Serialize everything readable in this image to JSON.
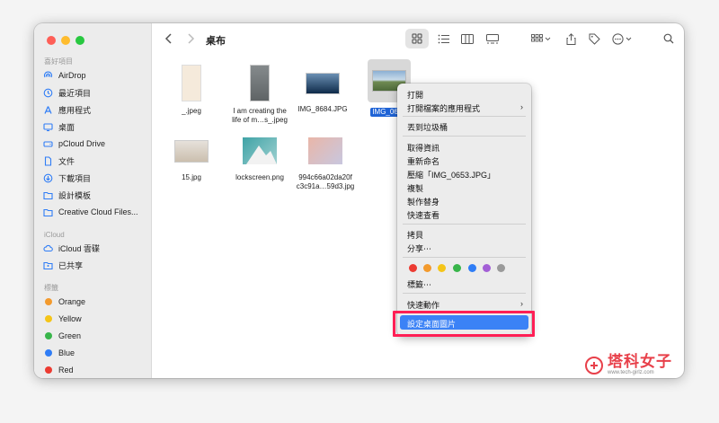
{
  "toolbar": {
    "title": "桌布"
  },
  "sidebar": {
    "favorites_title": "喜好項目",
    "favorites": [
      {
        "label": "AirDrop",
        "icon": "airdrop-icon"
      },
      {
        "label": "最近項目",
        "icon": "clock-icon"
      },
      {
        "label": "應用程式",
        "icon": "apps-icon"
      },
      {
        "label": "桌面",
        "icon": "desktop-icon"
      },
      {
        "label": "pCloud Drive",
        "icon": "drive-icon"
      },
      {
        "label": "文件",
        "icon": "document-icon"
      },
      {
        "label": "下載項目",
        "icon": "download-icon"
      },
      {
        "label": "設計模板",
        "icon": "folder-icon"
      },
      {
        "label": "Creative Cloud Files...",
        "icon": "folder-icon"
      }
    ],
    "icloud_title": "iCloud",
    "icloud": [
      {
        "label": "iCloud 雲碟",
        "icon": "cloud-icon"
      },
      {
        "label": "已共享",
        "icon": "shared-folder-icon"
      }
    ],
    "tags_title": "標籤",
    "tags": [
      {
        "label": "Orange",
        "color": "#f39a2d"
      },
      {
        "label": "Yellow",
        "color": "#f5c518"
      },
      {
        "label": "Green",
        "color": "#38b54a"
      },
      {
        "label": "Blue",
        "color": "#2f7df6"
      },
      {
        "label": "Red",
        "color": "#ec3b32"
      }
    ]
  },
  "files": [
    {
      "line1": "_.jpeg",
      "line2": ""
    },
    {
      "line1": "I am creating the",
      "line2": "life of m…s_.jpeg"
    },
    {
      "line1": "IMG_8684.JPG",
      "line2": ""
    },
    {
      "line1": "IMG_0653",
      "line2": ""
    },
    {
      "line1": "15.jpg",
      "line2": ""
    },
    {
      "line1": "lockscreen.png",
      "line2": ""
    },
    {
      "line1": "994c66a02da20f",
      "line2": "c3c91a…59d3.jpg"
    }
  ],
  "menu": {
    "items": [
      "打開",
      "打開檔案的應用程式",
      "丟到垃圾桶",
      "取得資訊",
      "重新命名",
      "壓縮「IMG_0653.JPG」",
      "複製",
      "製作替身",
      "快速查看",
      "拷貝",
      "分享⋯",
      "標籤⋯",
      "快速動作",
      "設定桌面圖片"
    ],
    "tag_colors": [
      "#ec3b32",
      "#f39a2d",
      "#f5c518",
      "#38b54a",
      "#2f7df6",
      "#a35fd6",
      "#9a9a9a"
    ]
  },
  "watermark": {
    "text": "塔科女子",
    "sub": "www.tech-girlz.com"
  },
  "colors": {
    "accent": "#3b82f6",
    "highlight_box": "#ff1f55",
    "selection": "#1f63d6"
  }
}
